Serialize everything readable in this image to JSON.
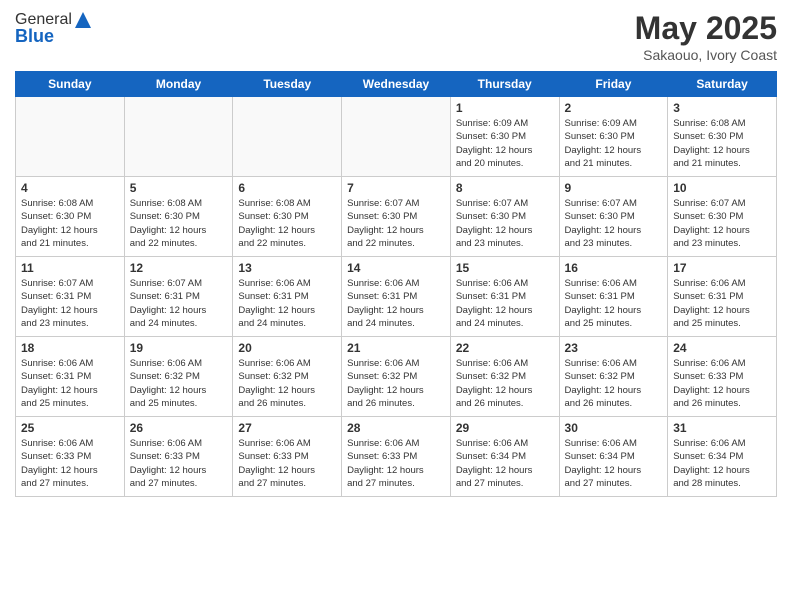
{
  "header": {
    "logo_general": "General",
    "logo_blue": "Blue",
    "month_year": "May 2025",
    "location": "Sakaouo, Ivory Coast"
  },
  "days_of_week": [
    "Sunday",
    "Monday",
    "Tuesday",
    "Wednesday",
    "Thursday",
    "Friday",
    "Saturday"
  ],
  "weeks": [
    [
      {
        "day": "",
        "info": ""
      },
      {
        "day": "",
        "info": ""
      },
      {
        "day": "",
        "info": ""
      },
      {
        "day": "",
        "info": ""
      },
      {
        "day": "1",
        "info": "Sunrise: 6:09 AM\nSunset: 6:30 PM\nDaylight: 12 hours\nand 20 minutes."
      },
      {
        "day": "2",
        "info": "Sunrise: 6:09 AM\nSunset: 6:30 PM\nDaylight: 12 hours\nand 21 minutes."
      },
      {
        "day": "3",
        "info": "Sunrise: 6:08 AM\nSunset: 6:30 PM\nDaylight: 12 hours\nand 21 minutes."
      }
    ],
    [
      {
        "day": "4",
        "info": "Sunrise: 6:08 AM\nSunset: 6:30 PM\nDaylight: 12 hours\nand 21 minutes."
      },
      {
        "day": "5",
        "info": "Sunrise: 6:08 AM\nSunset: 6:30 PM\nDaylight: 12 hours\nand 22 minutes."
      },
      {
        "day": "6",
        "info": "Sunrise: 6:08 AM\nSunset: 6:30 PM\nDaylight: 12 hours\nand 22 minutes."
      },
      {
        "day": "7",
        "info": "Sunrise: 6:07 AM\nSunset: 6:30 PM\nDaylight: 12 hours\nand 22 minutes."
      },
      {
        "day": "8",
        "info": "Sunrise: 6:07 AM\nSunset: 6:30 PM\nDaylight: 12 hours\nand 23 minutes."
      },
      {
        "day": "9",
        "info": "Sunrise: 6:07 AM\nSunset: 6:30 PM\nDaylight: 12 hours\nand 23 minutes."
      },
      {
        "day": "10",
        "info": "Sunrise: 6:07 AM\nSunset: 6:30 PM\nDaylight: 12 hours\nand 23 minutes."
      }
    ],
    [
      {
        "day": "11",
        "info": "Sunrise: 6:07 AM\nSunset: 6:31 PM\nDaylight: 12 hours\nand 23 minutes."
      },
      {
        "day": "12",
        "info": "Sunrise: 6:07 AM\nSunset: 6:31 PM\nDaylight: 12 hours\nand 24 minutes."
      },
      {
        "day": "13",
        "info": "Sunrise: 6:06 AM\nSunset: 6:31 PM\nDaylight: 12 hours\nand 24 minutes."
      },
      {
        "day": "14",
        "info": "Sunrise: 6:06 AM\nSunset: 6:31 PM\nDaylight: 12 hours\nand 24 minutes."
      },
      {
        "day": "15",
        "info": "Sunrise: 6:06 AM\nSunset: 6:31 PM\nDaylight: 12 hours\nand 24 minutes."
      },
      {
        "day": "16",
        "info": "Sunrise: 6:06 AM\nSunset: 6:31 PM\nDaylight: 12 hours\nand 25 minutes."
      },
      {
        "day": "17",
        "info": "Sunrise: 6:06 AM\nSunset: 6:31 PM\nDaylight: 12 hours\nand 25 minutes."
      }
    ],
    [
      {
        "day": "18",
        "info": "Sunrise: 6:06 AM\nSunset: 6:31 PM\nDaylight: 12 hours\nand 25 minutes."
      },
      {
        "day": "19",
        "info": "Sunrise: 6:06 AM\nSunset: 6:32 PM\nDaylight: 12 hours\nand 25 minutes."
      },
      {
        "day": "20",
        "info": "Sunrise: 6:06 AM\nSunset: 6:32 PM\nDaylight: 12 hours\nand 26 minutes."
      },
      {
        "day": "21",
        "info": "Sunrise: 6:06 AM\nSunset: 6:32 PM\nDaylight: 12 hours\nand 26 minutes."
      },
      {
        "day": "22",
        "info": "Sunrise: 6:06 AM\nSunset: 6:32 PM\nDaylight: 12 hours\nand 26 minutes."
      },
      {
        "day": "23",
        "info": "Sunrise: 6:06 AM\nSunset: 6:32 PM\nDaylight: 12 hours\nand 26 minutes."
      },
      {
        "day": "24",
        "info": "Sunrise: 6:06 AM\nSunset: 6:33 PM\nDaylight: 12 hours\nand 26 minutes."
      }
    ],
    [
      {
        "day": "25",
        "info": "Sunrise: 6:06 AM\nSunset: 6:33 PM\nDaylight: 12 hours\nand 27 minutes."
      },
      {
        "day": "26",
        "info": "Sunrise: 6:06 AM\nSunset: 6:33 PM\nDaylight: 12 hours\nand 27 minutes."
      },
      {
        "day": "27",
        "info": "Sunrise: 6:06 AM\nSunset: 6:33 PM\nDaylight: 12 hours\nand 27 minutes."
      },
      {
        "day": "28",
        "info": "Sunrise: 6:06 AM\nSunset: 6:33 PM\nDaylight: 12 hours\nand 27 minutes."
      },
      {
        "day": "29",
        "info": "Sunrise: 6:06 AM\nSunset: 6:34 PM\nDaylight: 12 hours\nand 27 minutes."
      },
      {
        "day": "30",
        "info": "Sunrise: 6:06 AM\nSunset: 6:34 PM\nDaylight: 12 hours\nand 27 minutes."
      },
      {
        "day": "31",
        "info": "Sunrise: 6:06 AM\nSunset: 6:34 PM\nDaylight: 12 hours\nand 28 minutes."
      }
    ]
  ]
}
